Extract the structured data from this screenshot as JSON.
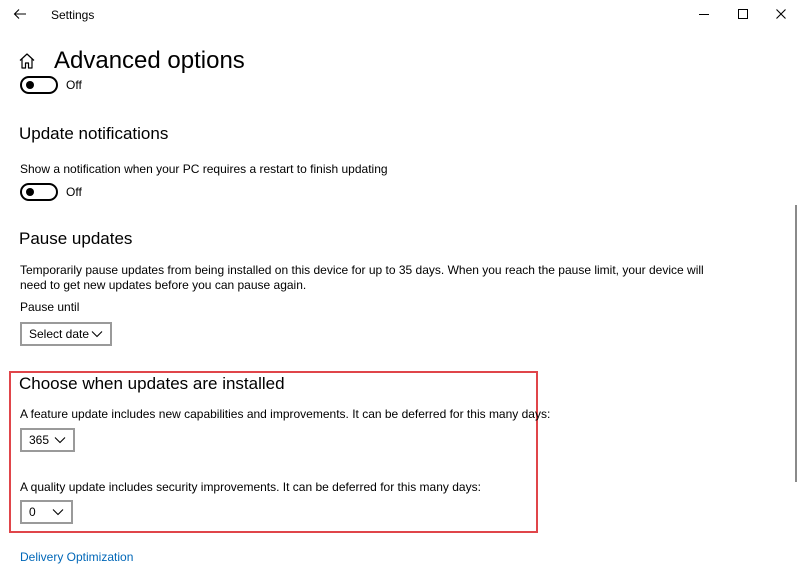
{
  "window": {
    "app_title": "Settings",
    "controls": [
      "minimize",
      "maximize",
      "close"
    ]
  },
  "page": {
    "title": "Advanced options"
  },
  "top_toggle": {
    "state": "Off",
    "on": false
  },
  "update_notifications": {
    "heading": "Update notifications",
    "description": "Show a notification when your PC requires a restart to finish updating",
    "toggle_state": "Off",
    "on": false
  },
  "pause_updates": {
    "heading": "Pause updates",
    "description_line1": "Temporarily pause updates from being installed on this device for up to 35 days. When you reach the pause limit, your device will",
    "description_line2": "need to get new updates before you can pause again.",
    "pause_until_label": "Pause until",
    "select_value": "Select date"
  },
  "defer_updates": {
    "heading": "Choose when updates are installed",
    "feature_label": "A feature update includes new capabilities and improvements. It can be deferred for this many days:",
    "feature_value": "365",
    "quality_label": "A quality update includes security improvements. It can be deferred for this many days:",
    "quality_value": "0",
    "highlight_color": "#e0454a"
  },
  "links": {
    "delivery_optimization": "Delivery Optimization",
    "link_color": "#0067b8"
  },
  "icons": [
    "back-arrow-icon",
    "home-icon",
    "minimize-icon",
    "maximize-icon",
    "close-icon",
    "chevron-down-icon"
  ]
}
